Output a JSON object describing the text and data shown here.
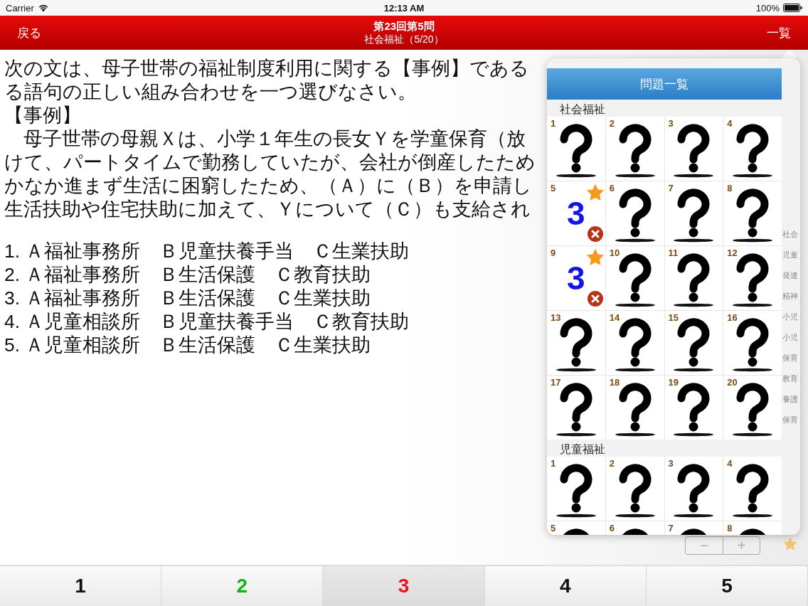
{
  "status_bar": {
    "carrier": "Carrier",
    "time": "12:13 AM",
    "battery": "100%"
  },
  "nav_bar": {
    "back": "戻る",
    "title": "第23回第5問",
    "subtitle": "社会福祉（5/20）",
    "list_button": "一覧"
  },
  "question": {
    "lines": [
      "次の文は、母子世帯の福祉制度利用に関する【事例】である",
      "る語句の正しい組み合わせを一つ選びなさい。",
      "【事例】",
      "　母子世帯の母親Ｘは、小学１年生の長女Ｙを学童保育（放",
      "けて、パートタイムで勤務していたが、会社が倒産したため",
      "かなか進まず生活に困窮したため、（Ａ）に（Ｂ）を申請し",
      "生活扶助や住宅扶助に加えて、Ｙについて（Ｃ）も支給され"
    ],
    "options": [
      "1. Ａ福祉事務所　Ｂ児童扶養手当　Ｃ生業扶助",
      "2. Ａ福祉事務所　Ｂ生活保護　Ｃ教育扶助",
      "3. Ａ福祉事務所　Ｂ生活保護　Ｃ生業扶助",
      "4. Ａ児童相談所　Ｂ児童扶養手当　Ｃ教育扶助",
      "5. Ａ児童相談所　Ｂ生活保護　Ｃ生業扶助"
    ]
  },
  "popover": {
    "title": "問題一覧",
    "sections": [
      {
        "name": "社会福祉",
        "cells": [
          {
            "number": "1",
            "kind": "unanswered",
            "starred": false
          },
          {
            "number": "2",
            "kind": "unanswered",
            "starred": false
          },
          {
            "number": "3",
            "kind": "unanswered",
            "starred": false
          },
          {
            "number": "4",
            "kind": "unanswered",
            "starred": false
          },
          {
            "number": "5",
            "kind": "answered",
            "answer": "3",
            "correct": false,
            "starred": true
          },
          {
            "number": "6",
            "kind": "unanswered",
            "starred": false
          },
          {
            "number": "7",
            "kind": "unanswered",
            "starred": false
          },
          {
            "number": "8",
            "kind": "unanswered",
            "starred": false
          },
          {
            "number": "9",
            "kind": "answered",
            "answer": "3",
            "correct": false,
            "starred": true
          },
          {
            "number": "10",
            "kind": "unanswered",
            "starred": false
          },
          {
            "number": "11",
            "kind": "unanswered",
            "starred": false
          },
          {
            "number": "12",
            "kind": "unanswered",
            "starred": false
          },
          {
            "number": "13",
            "kind": "unanswered",
            "starred": false
          },
          {
            "number": "14",
            "kind": "unanswered",
            "starred": false
          },
          {
            "number": "15",
            "kind": "unanswered",
            "starred": false
          },
          {
            "number": "16",
            "kind": "unanswered",
            "starred": false
          },
          {
            "number": "17",
            "kind": "unanswered",
            "starred": false
          },
          {
            "number": "18",
            "kind": "unanswered",
            "starred": false
          },
          {
            "number": "19",
            "kind": "unanswered",
            "starred": false
          },
          {
            "number": "20",
            "kind": "unanswered",
            "starred": false
          }
        ]
      },
      {
        "name": "児童福祉",
        "cells": [
          {
            "number": "1",
            "kind": "unanswered",
            "starred": false
          },
          {
            "number": "2",
            "kind": "unanswered",
            "starred": false
          },
          {
            "number": "3",
            "kind": "unanswered",
            "starred": false
          },
          {
            "number": "4",
            "kind": "unanswered",
            "starred": false
          },
          {
            "number": "5",
            "kind": "unanswered",
            "starred": false
          },
          {
            "number": "6",
            "kind": "unanswered",
            "starred": false
          },
          {
            "number": "7",
            "kind": "unanswered",
            "starred": false
          },
          {
            "number": "8",
            "kind": "unanswered",
            "starred": false
          }
        ]
      }
    ],
    "index": [
      "社会",
      "児童",
      "発達",
      "精神",
      "小児",
      "小児",
      "保育",
      "教育",
      "養護",
      "保育"
    ]
  },
  "font_stepper": {
    "minus": "−",
    "plus": "+"
  },
  "answer_buttons": [
    {
      "label": "1",
      "color": "#111111",
      "selected": false
    },
    {
      "label": "2",
      "color": "#16b316",
      "selected": false
    },
    {
      "label": "3",
      "color": "#e8141b",
      "selected": true
    },
    {
      "label": "4",
      "color": "#111111",
      "selected": false
    },
    {
      "label": "5",
      "color": "#111111",
      "selected": false
    }
  ]
}
